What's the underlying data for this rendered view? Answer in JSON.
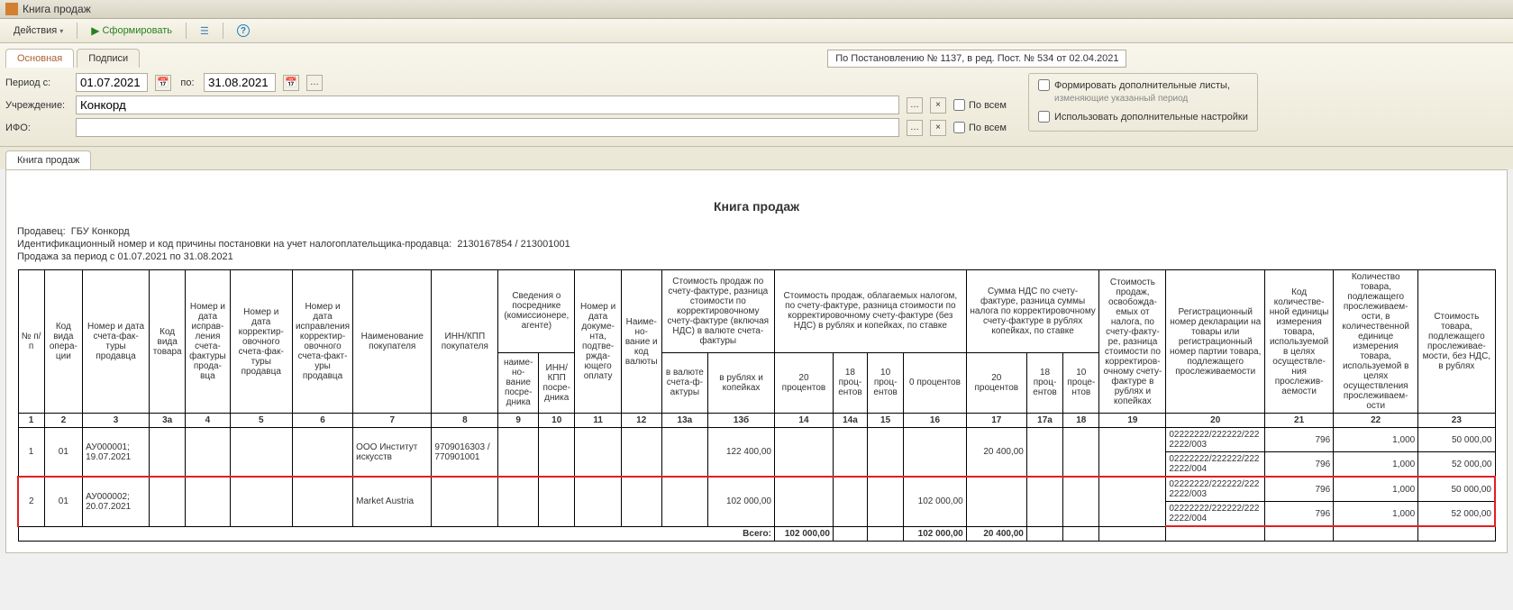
{
  "window": {
    "title": "Книга продаж"
  },
  "toolbar": {
    "actions": "Действия",
    "form": "Сформировать"
  },
  "tabs": {
    "main": "Основная",
    "signatures": "Подписи"
  },
  "banner": "По Постановлению № 1137, в ред. Пост. № 534 от 02.04.2021",
  "filters": {
    "period_from_label": "Период с:",
    "period_from": "01.07.2021",
    "period_to_label": "по:",
    "period_to": "31.08.2021",
    "org_label": "Учреждение:",
    "org_value": "Конкорд",
    "ifo_label": "ИФО:",
    "all": "По всем",
    "extra_sheets": "Формировать дополнительные листы,",
    "extra_sheets_sub": "изменяющие указанный период",
    "extra_settings": "Использовать дополнительные настройки"
  },
  "content_tab": "Книга продаж",
  "report": {
    "title": "Книга продаж",
    "seller_label": "Продавец:",
    "seller": "ГБУ Конкорд",
    "id_label": "Идентификационный номер и код причины постановки на учет налогоплательщика-продавца:",
    "id_value": "2130167854 / 213001001",
    "period_label": "Продажа за период с",
    "period_text": "01.07.2021 по 31.08.2021"
  },
  "headers": {
    "h1": "№ п/п",
    "h2": "Код вида опера­ции",
    "h3": "Номер и дата счета-фак­туры продавца",
    "h3a": "Код вида товара",
    "h4": "Номер и дата исправ­ления счета-фак­туры прода­вца",
    "h5": "Номер и дата корректир­овочного счета-фак­туры продавца",
    "h6": "Номер и дата исправлени­я корректир­овочного счета-факт­уры продавца",
    "h7": "Наименовани­е покупателя",
    "h8": "ИНН/КПП покупател­я",
    "h9_group": "Сведения о посреднике (комиссионер­е, агенте)",
    "h9": "наиме­но­вание посре­дника",
    "h10": "ИНН/К­ПП посре­дника",
    "h11": "Номер и дата докуме­нта, подтве­ржда­ющего оплату",
    "h12": "Наиме­но­вание и код валюты",
    "h13_group": "Стоимость продаж по счету-фактуре, разница стоимости по корректировочному счету-фактуре (включая НДС) в валюте счета-фактуры",
    "h13a": "в валюте счета-ф­актуры",
    "h13b": "в рублях и копейках",
    "h14_group": "Стоимость продаж, облагаемых налогом, по счету-фактуре, разница стоимости по корректировочному счету-фактуре (без НДС) в рублях и копейках, по ставке",
    "h14": "20 процентов",
    "h14a": "18 проц­енто­в",
    "h15": "10 проц­ентов",
    "h16": "0 процентов",
    "h17_group": "Сумма НДС по счету-фактуре, разница суммы налога по корректировочному счету-фактуре в рублях копейках, по ставке",
    "h17": "20 процентов",
    "h17a": "18 проц­ентов",
    "h18": "10 проце­нтов",
    "h19": "Стоимость продаж, освобожда­емых от налога, по счету-факту­ре, разница стоимости по корректиров­очному счету-фактур­е в рублях и копейках",
    "h20": "Регистрационны­й номер декларации на товары или регистрационны­й номер партии товара, подлежащего прослеживаемос­ти",
    "h21": "Код количестве­нной единицы измерения товара, используем­ой в целях осуществле­ния прослежив­аемости",
    "h22": "Количество товара, подлежащего прослеживаем­ости, в количественно­й единице измерения товара, используемой в целях осуществления прослеживаем­ости",
    "h23": "Стоимость товара, подлежащего прослеживае­мости, без НДС, в рублях"
  },
  "colnums": [
    "1",
    "2",
    "3",
    "3а",
    "4",
    "5",
    "6",
    "7",
    "8",
    "9",
    "10",
    "11",
    "12",
    "13а",
    "13б",
    "14",
    "14а",
    "15",
    "16",
    "17",
    "17а",
    "18",
    "19",
    "20",
    "21",
    "22",
    "23"
  ],
  "rows": [
    {
      "n": "1",
      "op": "01",
      "sf": "АУ000001; 19.07.2021",
      "buyer": "ООО Институт искусств",
      "inn": "9709016303 / 770901001",
      "c13b": "122 400,00",
      "c17": "20 400,00",
      "sub": [
        {
          "c20": "02222222/222222/2222222/003",
          "c21": "796",
          "c22": "1,000",
          "c23": "50 000,00"
        },
        {
          "c20": "02222222/222222/2222222/004",
          "c21": "796",
          "c22": "1,000",
          "c23": "52 000,00"
        }
      ]
    },
    {
      "n": "2",
      "op": "01",
      "sf": "АУ000002; 20.07.2021",
      "buyer": "Market Austria",
      "inn": "",
      "c13b": "102 000,00",
      "c16": "102 000,00",
      "sub": [
        {
          "c20": "02222222/222222/2222222/003",
          "c21": "796",
          "c22": "1,000",
          "c23": "50 000,00"
        },
        {
          "c20": "02222222/222222/2222222/004",
          "c21": "796",
          "c22": "1,000",
          "c23": "52 000,00"
        }
      ]
    }
  ],
  "totals": {
    "label": "Всего:",
    "c14": "102 000,00",
    "c16": "102 000,00",
    "c17": "20 400,00"
  }
}
